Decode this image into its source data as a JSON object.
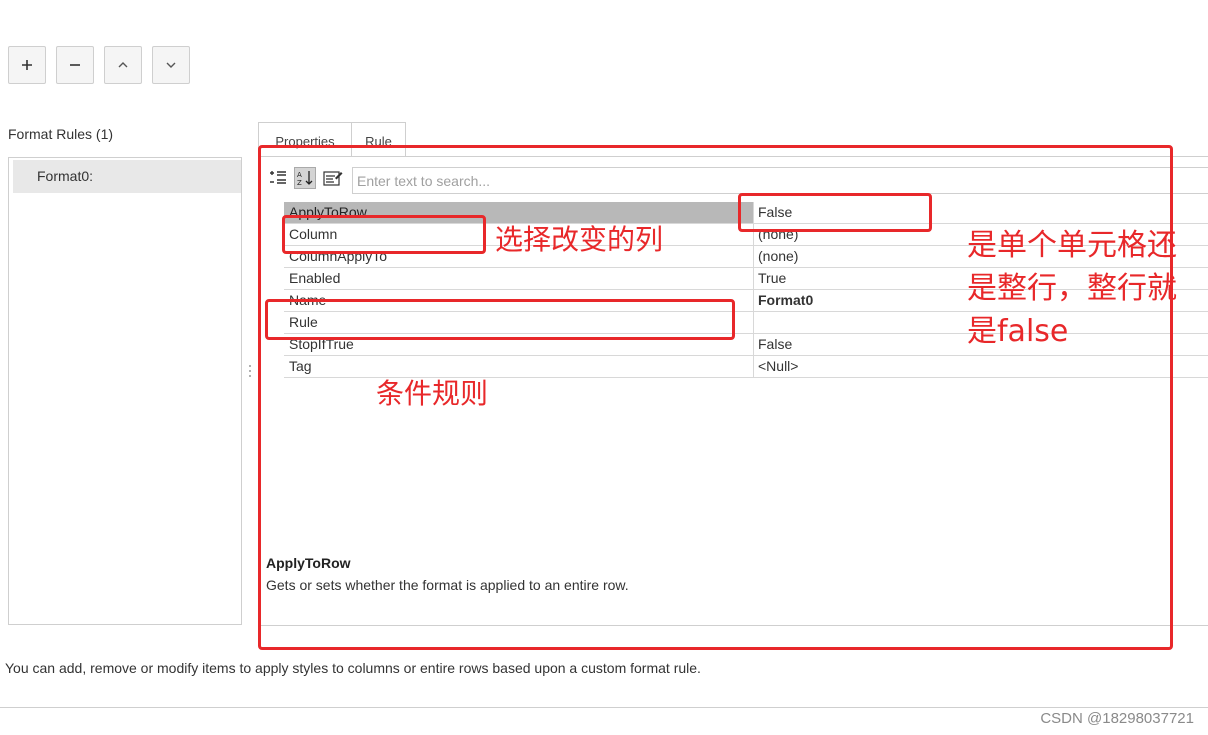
{
  "toolbar": {
    "add_icon": "plus-icon",
    "remove_icon": "minus-icon",
    "up_icon": "chevron-up-icon",
    "down_icon": "chevron-down-icon"
  },
  "left_panel": {
    "heading": "Format Rules (1)",
    "items": [
      {
        "label": "Format0:"
      }
    ]
  },
  "tabs": [
    {
      "label": "Properties",
      "active": true
    },
    {
      "label": "Rule",
      "active": false
    }
  ],
  "property_grid": {
    "search_placeholder": "Enter text to search...",
    "rows": [
      {
        "name": "ApplyToRow",
        "value": "False",
        "selected": true
      },
      {
        "name": "Column",
        "value": "(none)"
      },
      {
        "name": "ColumnApplyTo",
        "value": "(none)"
      },
      {
        "name": "Enabled",
        "value": "True"
      },
      {
        "name": "Name",
        "value": "Format0",
        "bold": true
      },
      {
        "name": "Rule",
        "value": ""
      },
      {
        "name": "StopIfTrue",
        "value": "False"
      },
      {
        "name": "Tag",
        "value": "<Null>"
      }
    ],
    "description_title": "ApplyToRow",
    "description_text": "Gets or sets whether the format is applied to an entire row."
  },
  "footer": {
    "text": "You can add, remove or modify items to apply styles to columns or entire rows based upon a custom format rule."
  },
  "annotations": {
    "column_note": "选择改变的列",
    "rule_note": "条件规则",
    "applytorow_note_1": "是单个单元格还",
    "applytorow_note_2": "是整行，整行就",
    "applytorow_note_3": "是false",
    "color": "#e8282a"
  },
  "watermark": "CSDN @18298037721"
}
